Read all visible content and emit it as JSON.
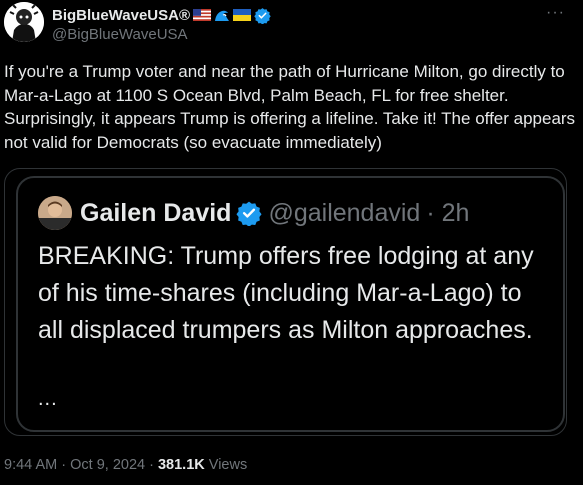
{
  "author": {
    "display_name": "BigBlueWaveUSA®",
    "handle": "@BigBlueWaveUSA",
    "verified": true,
    "emoji_icons": [
      "us-flag-icon",
      "wave-icon",
      "ukraine-flag-icon"
    ]
  },
  "post": {
    "text": "If you're a Trump voter and near the path of Hurricane Milton, go directly to Mar-a-Lago at 1100 S Ocean Blvd, Palm Beach, FL for free shelter. Surprisingly, it appears Trump is offering a lifeline. Take it! The offer appears not valid for Democrats (so evacuate immediately)"
  },
  "quoted": {
    "display_name": "Gailen David",
    "handle": "@gailendavid",
    "time": "· 2h",
    "verified": true,
    "text": "BREAKING: Trump offers free lodging at any of his time-shares (including Mar-a-Lago) to all displaced trumpers as Milton approaches.",
    "ellipsis": "..."
  },
  "meta": {
    "time": "9:44 AM",
    "sep1": "·",
    "date": "Oct 9, 2024",
    "sep2": "·",
    "views_count": "381.1K",
    "views_label": "Views"
  },
  "more_label": "···",
  "colors": {
    "background": "#000000",
    "text": "#e7e9ea",
    "secondary": "#71767b",
    "verified": "#1d9bf0",
    "border": "#2f3336"
  }
}
